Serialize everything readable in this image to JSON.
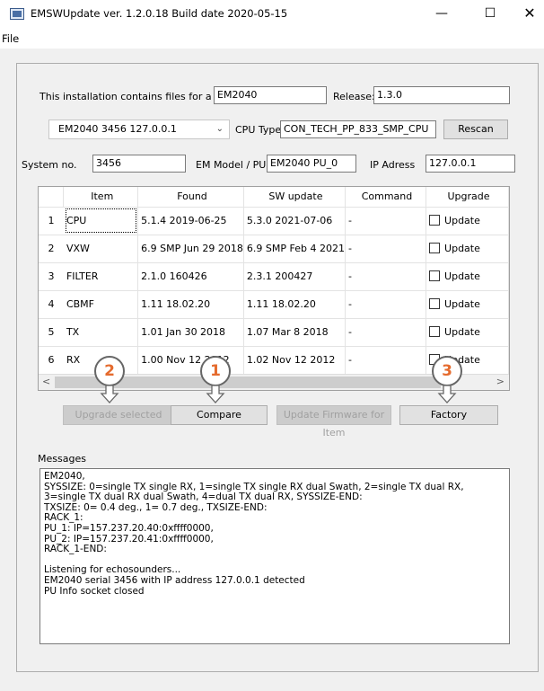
{
  "window": {
    "title": "EMSWUpdate ver. 1.2.0.18 Build date 2020-05-15",
    "minimize": "—",
    "maximize": "☐",
    "close": "✕"
  },
  "menu": {
    "file": "File"
  },
  "install": {
    "files_label": "This installation contains files for a",
    "files_value": "EM2040",
    "release_label": "Release:",
    "release_value": "1.3.0"
  },
  "device": {
    "selected": "EM2040 3456 127.0.0.1",
    "cpu_type_label": "CPU Type",
    "cpu_type_value": "CON_TECH_PP_833_SMP_CPU",
    "rescan_label": "Rescan"
  },
  "system": {
    "sysno_label": "System no.",
    "sysno_value": "3456",
    "model_label": "EM Model / PU#",
    "model_value": "EM2040  PU_0",
    "ip_label": "IP Adress",
    "ip_value": "127.0.0.1"
  },
  "grid": {
    "headers": [
      "Item",
      "Found",
      "SW update",
      "Command",
      "Upgrade"
    ],
    "rows": [
      {
        "num": "1",
        "item": "CPU",
        "found": "5.1.4 2019-06-25",
        "sw": "5.3.0 2021-07-06",
        "cmd": "-",
        "upgrade": "Update"
      },
      {
        "num": "2",
        "item": "VXW",
        "found": "6.9 SMP Jun 29 2018",
        "sw": "6.9 SMP Feb  4 2021",
        "cmd": "-",
        "upgrade": "Update"
      },
      {
        "num": "3",
        "item": "FILTER",
        "found": "2.1.0 160426",
        "sw": "2.3.1 200427",
        "cmd": "-",
        "upgrade": "Update"
      },
      {
        "num": "4",
        "item": "CBMF",
        "found": "1.11 18.02.20",
        "sw": "1.11 18.02.20",
        "cmd": "-",
        "upgrade": "Update"
      },
      {
        "num": "5",
        "item": "TX",
        "found": "1.01  Jan 30 2018",
        "sw": "1.07  Mar  8 2018",
        "cmd": "-",
        "upgrade": "Update"
      },
      {
        "num": "6",
        "item": "RX",
        "found": "1.00  Nov 12 2012",
        "sw": "1.02  Nov 12 2012",
        "cmd": "-",
        "upgrade": "Update"
      }
    ],
    "scroll_left": "<",
    "scroll_right": ">"
  },
  "callouts": [
    "2",
    "1",
    "3"
  ],
  "buttons": {
    "upgrade_selected": "Upgrade selected",
    "compare": "Compare",
    "update_firmware": "Update Firmware for Item",
    "factory": "Factory"
  },
  "messages": {
    "label": "Messages",
    "text": "EM2040,\nSYSSIZE: 0=single TX single RX, 1=single TX single RX dual Swath, 2=single TX dual RX, 3=single TX dual RX dual Swath, 4=dual TX dual RX, SYSSIZE-END:\nTXSIZE: 0= 0.4 deg., 1= 0.7 deg., TXSIZE-END:\nRACK_1:\nPU_1: IP=157.237.20.40:0xffff0000,\nPU_2: IP=157.237.20.41:0xffff0000,\nRACK_1-END:\n\nListening for echosounders...\nEM2040 serial 3456 with IP address 127.0.0.1 detected\nPU Info socket closed"
  },
  "colors": {
    "callout_text": "#e56b2e",
    "client_bg": "#f0f0f0"
  }
}
